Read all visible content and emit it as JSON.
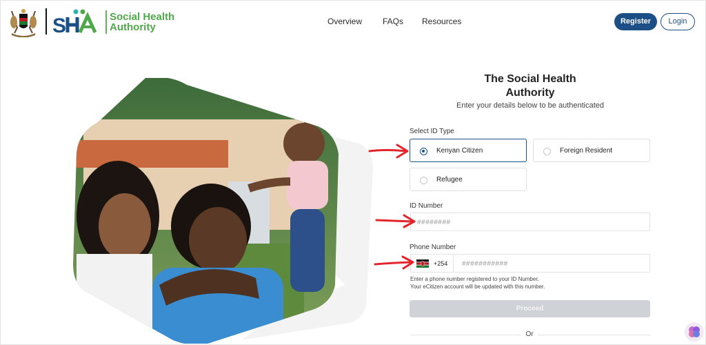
{
  "header": {
    "brand_line1": "Social Health",
    "brand_line2": "Authority",
    "logo_icon": "sha-logo-icon",
    "crest_icon": "coat-of-arms-icon",
    "nav": [
      "Overview",
      "FAQs",
      "Resources"
    ],
    "register_label": "Register",
    "login_label": "Login"
  },
  "form": {
    "title_line1": "The Social Health",
    "title_line2": "Authority",
    "subtitle": "Enter your details below to be authenticated",
    "id_type_label": "Select ID Type",
    "id_types": [
      "Kenyan Citizen",
      "Foreign Resident",
      "Refugee"
    ],
    "selected_id_type": "Kenyan Citizen",
    "id_number_label": "ID Number",
    "id_number_placeholder": "########",
    "phone_label": "Phone Number",
    "country_code": "+254",
    "phone_placeholder": "###########",
    "help_line1": "Enter a phone number registered to your ID Number.",
    "help_line2": "Your eCitizen account will be updated with this number.",
    "proceed_label": "Proceed",
    "or_label": "Or"
  },
  "colors": {
    "primary": "#1b4f86",
    "brand_green": "#4fa84a",
    "annotation_red": "#e3242b",
    "disabled_button": "#cfd2d6"
  }
}
